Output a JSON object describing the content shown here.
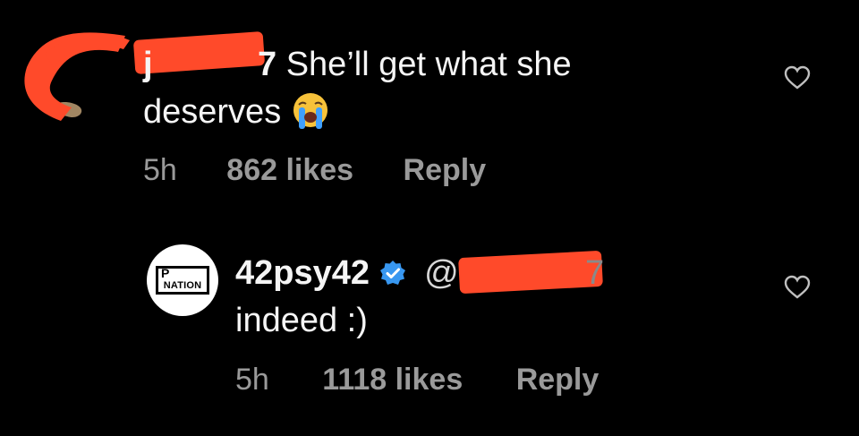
{
  "comment": {
    "username": "j",
    "username_suffix": "7",
    "text_line1": "She’ll get what she",
    "text_line2": "deserves",
    "time": "5h",
    "likes": "862 likes",
    "reply_label": "Reply",
    "emoji": "loudly-crying-face"
  },
  "reply": {
    "avatar_logo_top": "P",
    "avatar_logo_bottom": "NATION",
    "username": "42psy42",
    "mention_prefix": "@",
    "mention_suffix": "7",
    "text": "indeed :)",
    "time": "5h",
    "likes": "1118 likes",
    "reply_label": "Reply"
  },
  "colors": {
    "background": "#000000",
    "redaction": "#ff4a2a",
    "verified": "#3897f0",
    "meta_text": "#9a9a9a"
  }
}
